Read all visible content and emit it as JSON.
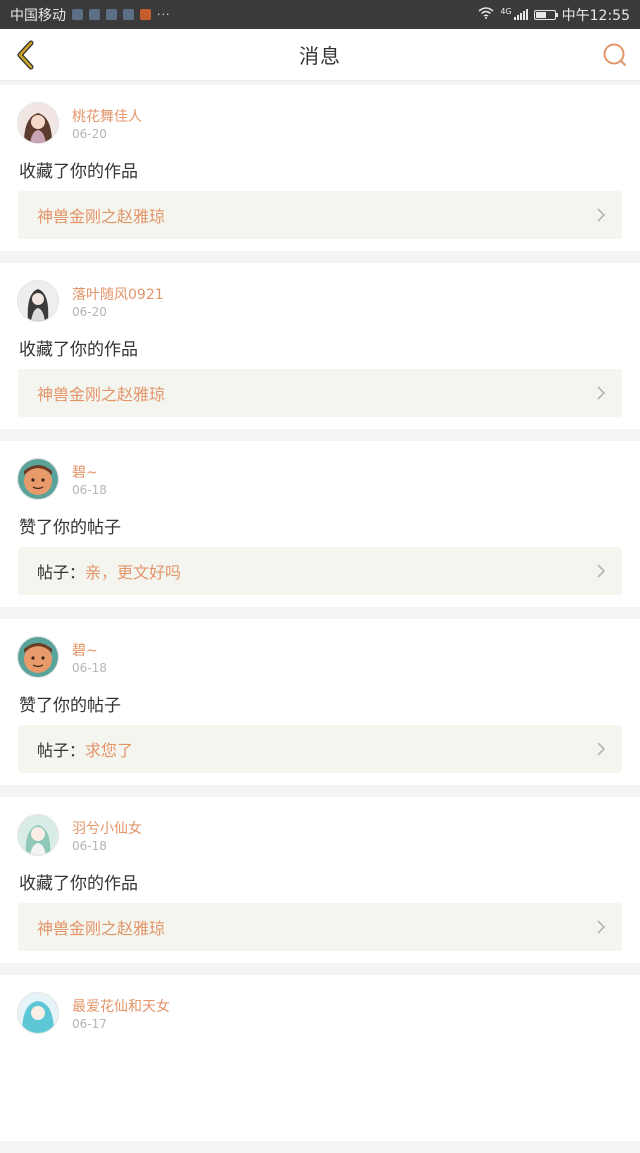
{
  "statusbar": {
    "carrier": "中国移动",
    "dots": "···",
    "network": "4G",
    "time": "中午12:55",
    "battery_level": 0.55
  },
  "header": {
    "title": "消息",
    "back_icon": "back-chevron-icon",
    "search_icon": "search-icon"
  },
  "colors": {
    "accent": "#e3956a",
    "back_icon": "#c9a32a",
    "ref_bg": "#f5f5ef"
  },
  "messages": [
    {
      "username": "桃花舞佳人",
      "date": "06-20",
      "action": "收藏了你的作品",
      "ref_prefix": "",
      "ref_text": "神兽金刚之赵雅琼"
    },
    {
      "username": "落叶随风0921",
      "date": "06-20",
      "action": "收藏了你的作品",
      "ref_prefix": "",
      "ref_text": "神兽金刚之赵雅琼"
    },
    {
      "username": "碧~",
      "date": "06-18",
      "action": "赞了你的帖子",
      "ref_prefix": "帖子：",
      "ref_text": "亲，更文好吗"
    },
    {
      "username": "碧~",
      "date": "06-18",
      "action": "赞了你的帖子",
      "ref_prefix": "帖子：",
      "ref_text": "求您了"
    },
    {
      "username": "羽兮小仙女",
      "date": "06-18",
      "action": "收藏了你的作品",
      "ref_prefix": "",
      "ref_text": "神兽金刚之赵雅琼"
    },
    {
      "username": "最爱花仙和天女",
      "date": "06-17",
      "action": "",
      "ref_prefix": "",
      "ref_text": ""
    }
  ]
}
